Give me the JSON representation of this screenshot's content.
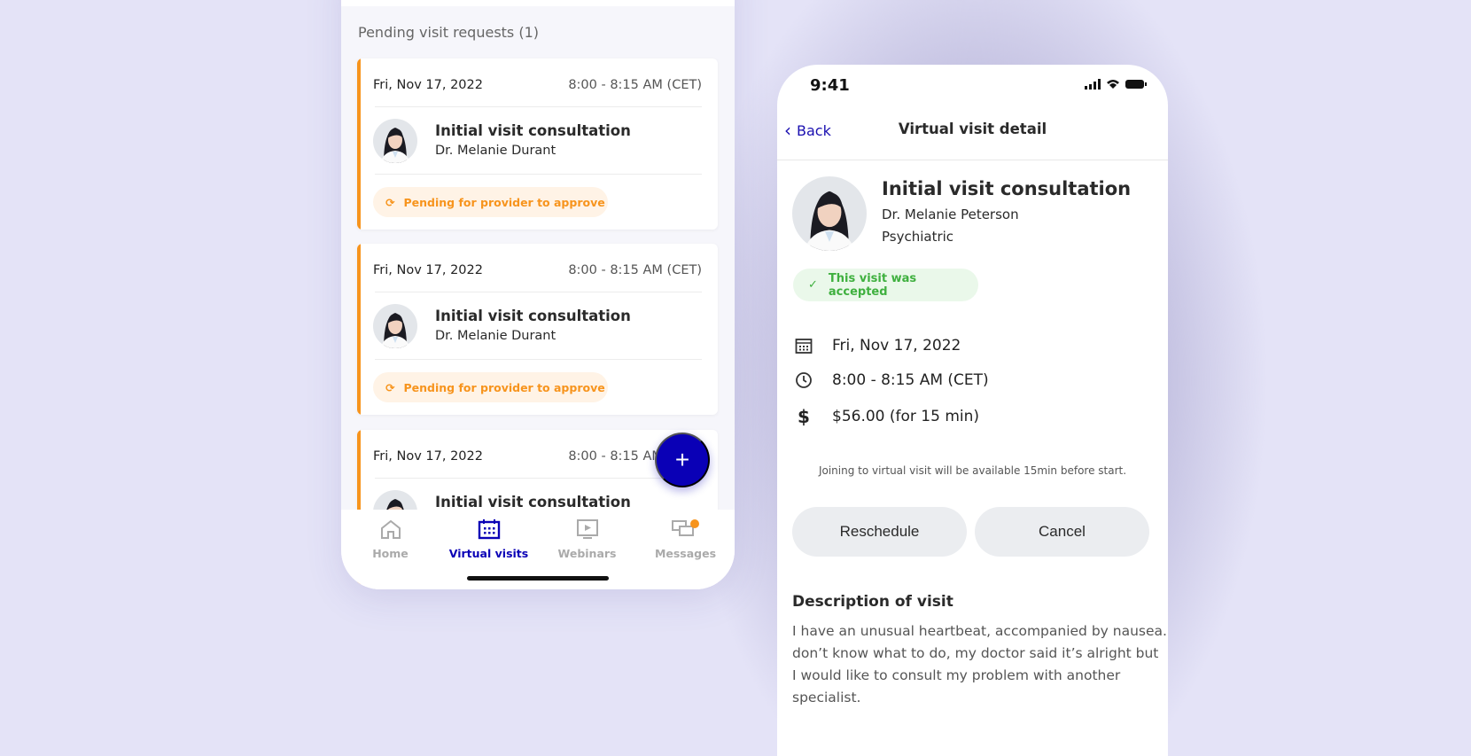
{
  "left_phone": {
    "section_title": "Pending visit requests (1)",
    "cards": [
      {
        "date": "Fri, Nov 17, 2022",
        "time": "8:00 - 8:15 AM (CET)",
        "title": "Initial visit consultation",
        "doctor": "Dr. Melanie Durant",
        "status": "Pending for provider to approve"
      },
      {
        "date": "Fri, Nov 17, 2022",
        "time": "8:00 - 8:15 AM (CET)",
        "title": "Initial visit consultation",
        "doctor": "Dr. Melanie Durant",
        "status": "Pending for provider to approve"
      },
      {
        "date": "Fri, Nov 17, 2022",
        "time": "8:00 - 8:15 AM (CET)",
        "title": "Initial visit consultation"
      }
    ],
    "fab_label": "+",
    "tabs": [
      {
        "label": "Home",
        "icon": "home-icon"
      },
      {
        "label": "Virtual visits",
        "icon": "calendar-icon",
        "active": true
      },
      {
        "label": "Webinars",
        "icon": "play-icon"
      },
      {
        "label": "Messages",
        "icon": "chat-icon",
        "badge": true
      }
    ]
  },
  "right_phone": {
    "status_time": "9:41",
    "back_label": "Back",
    "nav_title": "Virtual visit detail",
    "title": "Initial visit consultation",
    "doctor": "Dr. Melanie Peterson",
    "specialty": "Psychiatric",
    "status": "This visit was accepted",
    "date": "Fri, Nov 17, 2022",
    "time": "8:00 - 8:15 AM (CET)",
    "price": "$56.00  (for 15 min)",
    "note": "Joining to virtual visit will be available 15min before start.",
    "reschedule_label": "Reschedule",
    "cancel_label": "Cancel",
    "description_heading": "Description of visit",
    "description_lines": [
      "I have an unusual heartbeat, accompanied by nausea. I",
      "don’t know what to do, my doctor said it’s alright but",
      "I would like to consult my problem with another",
      "specialist."
    ]
  },
  "colors": {
    "accent": "#0a00b6",
    "pending": "#f7941d",
    "accepted": "#3fb03f",
    "background": "#e4e3f7"
  }
}
